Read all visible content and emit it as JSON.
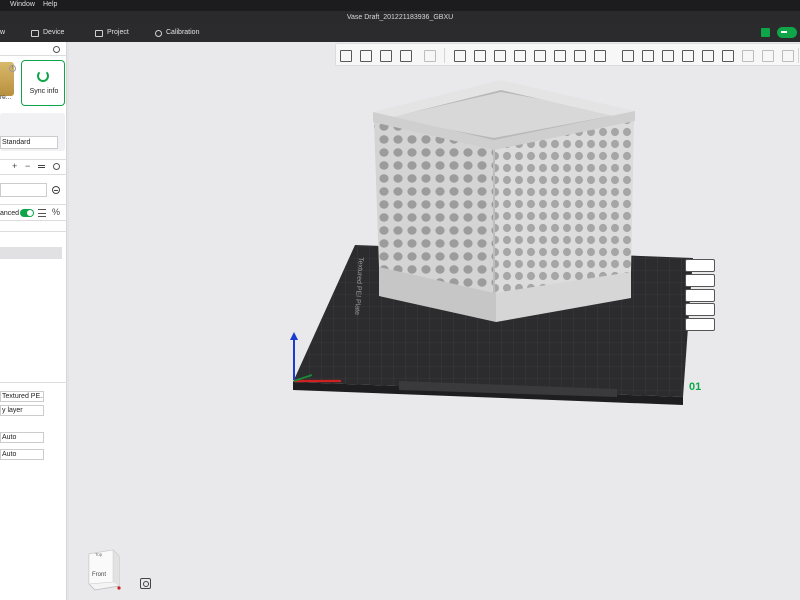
{
  "menubar": {
    "items": [
      "Window",
      "Help"
    ]
  },
  "window": {
    "title": "Vase Draft_201221183936_GBXU"
  },
  "topnav": {
    "tabs": [
      {
        "label": "w",
        "icon": "prepare-icon"
      },
      {
        "label": "Device",
        "icon": "device-icon"
      },
      {
        "label": "Project",
        "icon": "project-icon"
      },
      {
        "label": "Calibration",
        "icon": "calibration-icon"
      }
    ]
  },
  "sidebar": {
    "printer_label": "re...",
    "info_symbol": "i",
    "sync_label": "Sync info",
    "plate_type": "Standard",
    "filament_controls": [
      "+",
      "−"
    ],
    "advanced_label": "anced",
    "percent_symbol": "%",
    "fields": {
      "plate_surface": "Textured PE...",
      "sequence": "y layer",
      "auto_1": "Auto",
      "auto_2": "Auto"
    }
  },
  "viewport": {
    "plate_text": "Textured PEI Plate",
    "plate_number": "01",
    "navcube_face": "Front",
    "navcube_top": "Top"
  },
  "colors": {
    "accent": "#0fa64a",
    "axis_x": "#d02020",
    "axis_y": "#1a8a3a",
    "axis_z": "#1a3ad0",
    "plate": "#2c2c2e",
    "model": "#dcdcdc"
  }
}
